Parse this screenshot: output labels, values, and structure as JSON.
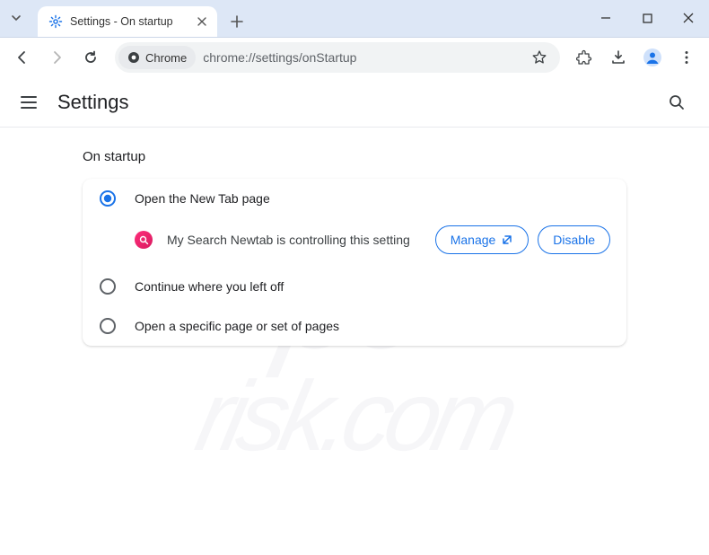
{
  "tab": {
    "title": "Settings - On startup"
  },
  "url": {
    "chip_label": "Chrome",
    "path": "chrome://settings/onStartup"
  },
  "page_title": "Settings",
  "section": {
    "heading": "On startup",
    "options": [
      {
        "label": "Open the New Tab page"
      },
      {
        "label": "Continue where you left off"
      },
      {
        "label": "Open a specific page or set of pages"
      }
    ],
    "extension_notice": {
      "text": "My Search Newtab is controlling this setting",
      "manage_label": "Manage",
      "disable_label": "Disable"
    }
  },
  "watermark": {
    "line1": "pc",
    "line2": "risk.com"
  }
}
